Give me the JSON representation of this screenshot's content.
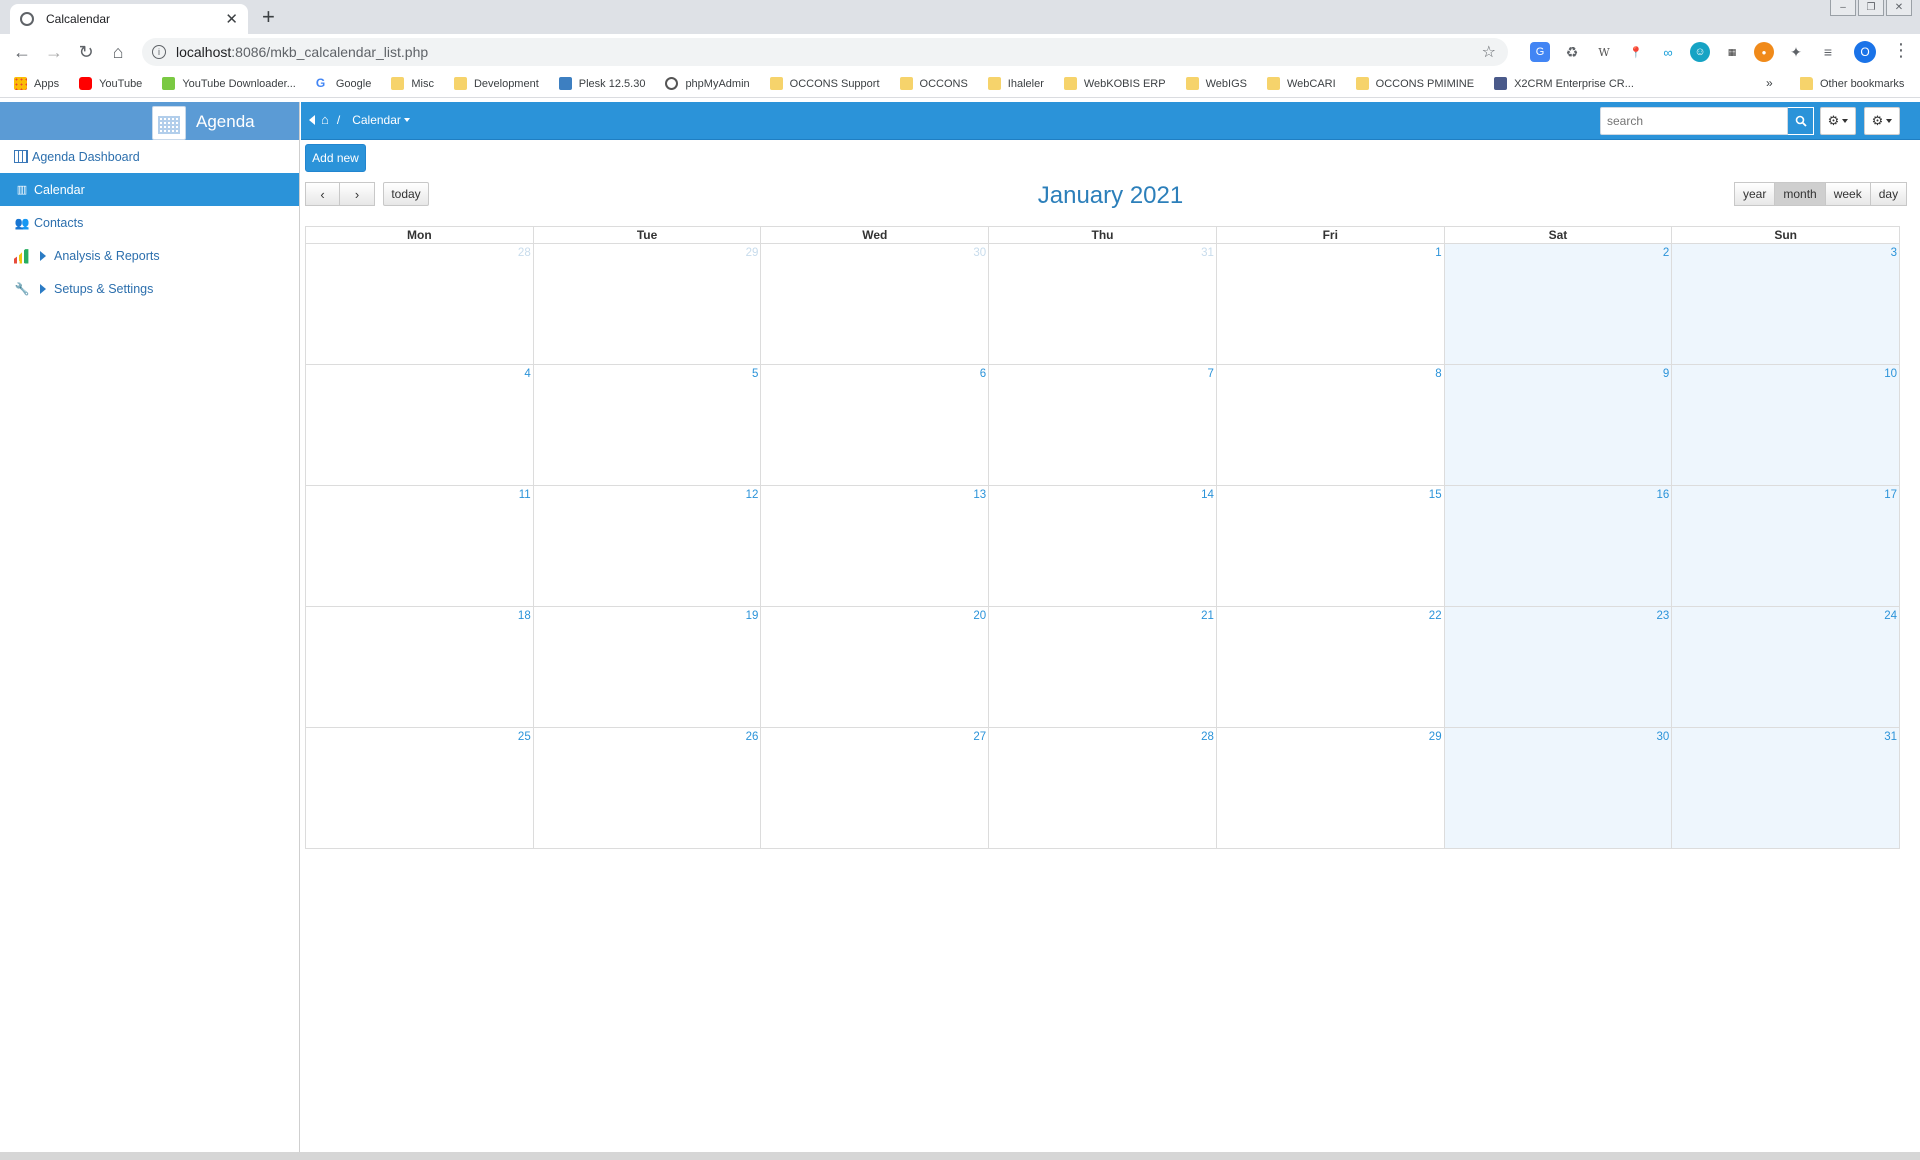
{
  "browser": {
    "tab_title": "Calcalendar",
    "url_host": "localhost",
    "url_rest": ":8086/mkb_calcalendar_list.php",
    "bookmarks": [
      "Apps",
      "YouTube",
      "YouTube Downloader...",
      "Google",
      "Misc",
      "Development",
      "Plesk 12.5.30",
      "phpMyAdmin",
      "OCCONS Support",
      "OCCONS",
      "Ihaleler",
      "WebKOBIS ERP",
      "WebIGS",
      "WebCARI",
      "OCCONS PMIMINE",
      "X2CRM Enterprise CR..."
    ],
    "other_bookmarks": "Other bookmarks",
    "profile_initial": "O"
  },
  "sidebar": {
    "app_title": "Agenda",
    "items": [
      {
        "label": "Agenda Dashboard"
      },
      {
        "label": "Calendar"
      },
      {
        "label": "Contacts"
      },
      {
        "label": "Analysis & Reports"
      },
      {
        "label": "Setups & Settings"
      }
    ]
  },
  "topbar": {
    "breadcrumb_sep": "/",
    "breadcrumb_current": "Calendar",
    "search_placeholder": "search"
  },
  "calendar": {
    "add_new": "Add new",
    "today": "today",
    "title": "January 2021",
    "views": [
      "year",
      "month",
      "week",
      "day"
    ],
    "active_view": "month",
    "weekdays": [
      "Mon",
      "Tue",
      "Wed",
      "Thu",
      "Fri",
      "Sat",
      "Sun"
    ],
    "weeks": [
      [
        "28",
        "29",
        "30",
        "31",
        "1",
        "2",
        "3"
      ],
      [
        "4",
        "5",
        "6",
        "7",
        "8",
        "9",
        "10"
      ],
      [
        "11",
        "12",
        "13",
        "14",
        "15",
        "16",
        "17"
      ],
      [
        "18",
        "19",
        "20",
        "21",
        "22",
        "23",
        "24"
      ],
      [
        "25",
        "26",
        "27",
        "28",
        "29",
        "30",
        "31"
      ]
    ]
  },
  "colors": {
    "accent": "#2b93d9",
    "sidebar_header": "#5b9bd5",
    "weekend_bg": "#eef6fd"
  }
}
